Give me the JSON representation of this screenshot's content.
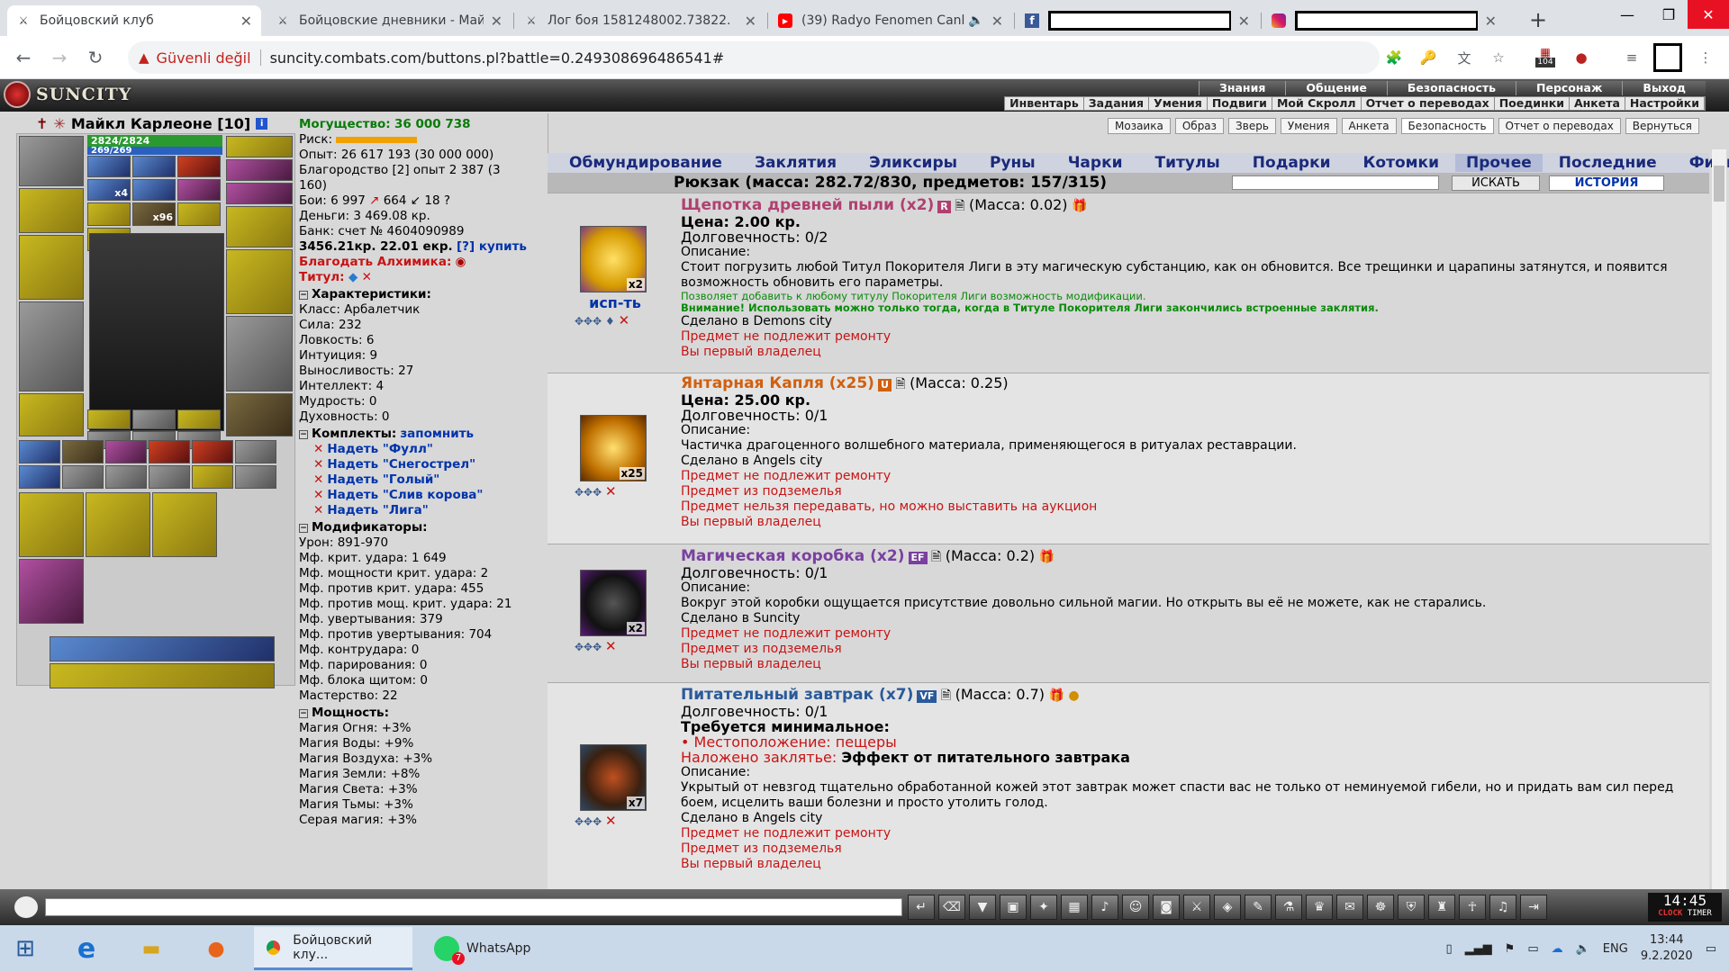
{
  "browser": {
    "tabs": [
      {
        "title": "Бойцовский клуб",
        "icon": "swords-icon"
      },
      {
        "title": "Бойцовские дневники - Май",
        "icon": "swords-icon"
      },
      {
        "title": "Лог боя 1581248002.73822.",
        "icon": "swords-icon"
      },
      {
        "title": "(39) Radyo Fenomen Canl",
        "icon": "youtube-icon"
      },
      {
        "title": "",
        "icon": "facebook-icon"
      },
      {
        "title": "",
        "icon": "instagram-icon"
      }
    ],
    "insecure_label": "Güvenli değil",
    "url": "suncity.combats.com/buttons.pl?battle=0.249308696486541#",
    "ext_badge": "104"
  },
  "game": {
    "logo": "SUNCITY",
    "top_menu": [
      "Знания",
      "Общение",
      "Безопасность",
      "Персонаж",
      "Выход"
    ],
    "sub_menu": [
      "Инвентарь",
      "Задания",
      "Умения",
      "Подвиги",
      "Мой Скролл",
      "Отчет о переводах",
      "Поединки",
      "Анкета",
      "Настройки"
    ],
    "char_name": "Майкл Карлеоне [10]",
    "hp": "2824/2824",
    "mp": "269/269",
    "slot_counts": {
      "x4": "x4",
      "x96": "x96"
    },
    "stats": {
      "power_label": "Могущество:",
      "power": "36 000 738",
      "risk_label": "Риск:",
      "exp": "Опыт: 26 617 193 (30 000 000)",
      "noble": "Благородство [2] опыт 2 387 (3",
      "noble2": "160)",
      "fights": "Бои:   6 997",
      "fights_win": "664",
      "fights_draw": "18",
      "money": "Деньги: 3 469.08 кр.",
      "bank": "Банк: счет № 4604090989",
      "balance": "3456.21кр. 22.01 екр.",
      "buy": "[?] купить",
      "alchemist": "Благодать Алхимика:",
      "title_label": "Титул:",
      "char_section": "Характеристики:",
      "class": "Класс: Арбалетчик",
      "str": "Сила: 232",
      "dex": "Ловкость: 6",
      "int_": "Интуиция: 9",
      "end": "Выносливость: 27",
      "intel": "Интеллект: 4",
      "wis": "Мудрость: 0",
      "spirit": "Духовность: 0",
      "kits_section": "Комплекты:",
      "remember": "запомнить",
      "kits": [
        "Надеть \"Фулл\"",
        "Надеть \"Снегострел\"",
        "Надеть \"Голый\"",
        "Надеть \"Слив корова\"",
        "Надеть \"Лига\""
      ],
      "mods_section": "Модификаторы:",
      "mods": [
        "Урон: 891-970",
        "Мф. крит. удара: 1 649",
        "Мф. мощности крит. удара: 2",
        "Мф. против крит. удара: 455",
        "Мф. против мощ. крит. удара: 21",
        "Мф. увертывания: 379",
        "Мф. против увертывания: 704",
        "Мф. контрудара: 0",
        "Мф. парирования: 0",
        "Мф. блока щитом: 0",
        "Мастерство: 22"
      ],
      "powers_section": "Мощность:",
      "powers": [
        "Магия Огня: +3%",
        "Магия Воды: +9%",
        "Магия Воздуха: +3%",
        "Магия Земли: +8%",
        "Магия Света: +3%",
        "Магия Тьмы: +3%",
        "Серая магия: +3%"
      ]
    },
    "top_buttons": [
      "Мозаика",
      "Образ",
      "Зверь",
      "Умения",
      "Анкета",
      "Безопасность",
      "Отчет о переводах",
      "Вернуться"
    ],
    "categories": [
      "Обмундирование",
      "Заклятия",
      "Эликсиры",
      "Руны",
      "Чарки",
      "Титулы",
      "Подарки",
      "Котомки",
      "Прочее",
      "Последние",
      "Фильтр"
    ],
    "selected_category": "Прочее",
    "rucksack": "Рюкзак (масса: 282.72/830, предметов: 157/315)",
    "search_btn": "ИСКАТЬ",
    "history_btn": "ИСТОРИЯ",
    "items": [
      {
        "name": "Щепотка древней пыли (x2)",
        "badge": "R",
        "mass": "(Масса: 0.02)",
        "price": "Цена: 2.00 кр.",
        "dur": "Долговечность: 0/2",
        "desc_label": "Описание:",
        "desc": "Стоит погрузить любой Титул Покорителя Лиги в эту магическую субстанцию, как он обновится. Все трещинки и царапины затянутся, и появится возможность обновить его параметры.",
        "note1": "Позволяет добавить к любому титулу Покорителя Лиги возможность модификации.",
        "note2": "Внимание! Использовать можно только тогда, когда в Титуле Покорителя Лиги закончились встроенные заклятия.",
        "made": "Сделано в Demons city",
        "flags": [
          "Предмет не подлежит ремонту",
          "Вы первый владелец"
        ],
        "count": "x2",
        "use": "исп-ть"
      },
      {
        "name": "Янтарная Капля (x25)",
        "badge": "U",
        "mass": "(Масса: 0.25)",
        "price": "Цена: 25.00 кр.",
        "dur": "Долговечность: 0/1",
        "desc_label": "Описание:",
        "desc": "Частичка драгоценного волшебного материала, применяющегося в ритуалах реставрации.",
        "made": "Сделано в Angels city",
        "flags": [
          "Предмет не подлежит ремонту",
          "Предмет из подземелья",
          "Предмет нельзя передавать, но можно выставить на аукцион",
          "Вы первый владелец"
        ],
        "count": "x25"
      },
      {
        "name": "Магическая коробка (x2)",
        "badge": "EF",
        "mass": "(Масса: 0.2)",
        "dur": "Долговечность: 0/1",
        "desc_label": "Описание:",
        "desc": "Вокруг этой коробки ощущается присутствие довольно сильной магии. Но открыть вы её не можете, как не старались.",
        "made": "Сделано в Suncity",
        "flags": [
          "Предмет не подлежит ремонту",
          "Предмет из подземелья",
          "Вы первый владелец"
        ],
        "count": "x2"
      },
      {
        "name": "Питательный завтрак (x7)",
        "badge": "VF",
        "mass": "(Масса: 0.7)",
        "dur": "Долговечность: 0/1",
        "req": "Требуется минимальное:",
        "location": "• Местоположение: пещеры",
        "enchant_label": "Наложено заклятье:",
        "enchant": "Эффект от питательного завтрака",
        "desc_label": "Описание:",
        "desc": "Укрытый от невзгод тщательно обработанной кожей этот завтрак может спасти вас не только от неминуемой гибели, но и придать вам сил перед боем, исцелить ваши болезни и просто утолить голод.",
        "made": "Сделано в Angels city",
        "flags": [
          "Предмет не подлежит ремонту",
          "Предмет из подземелья",
          "Вы первый владелец"
        ],
        "count": "x7"
      }
    ],
    "clock": {
      "time": "14:45",
      "clock_lbl": "CLOCK",
      "timer_lbl": "TIMER"
    }
  },
  "taskbar": {
    "apps": [
      {
        "label": "Бойцовский клу..."
      },
      {
        "label": "WhatsApp",
        "badge": "7"
      }
    ],
    "lang": "ENG",
    "time": "13:44",
    "date": "9.2.2020"
  }
}
